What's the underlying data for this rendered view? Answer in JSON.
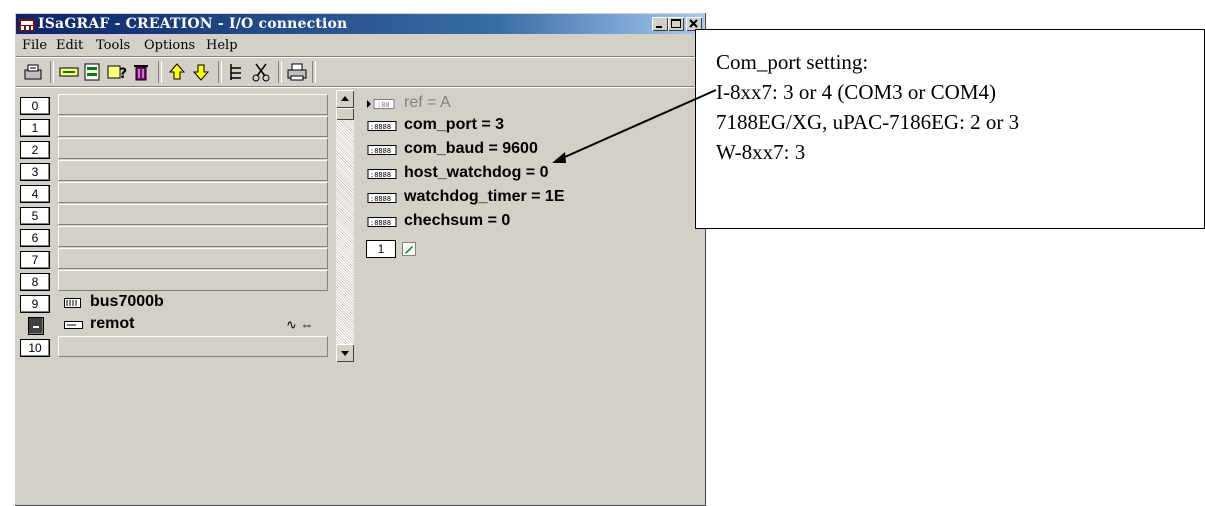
{
  "window": {
    "title": "ISaGRAF - CREATION - I/O connection"
  },
  "menu": {
    "file": "File",
    "edit": "Edit",
    "tools": "Tools",
    "options": "Options",
    "help": "Help"
  },
  "toolbar": {
    "icons": [
      "open-icon",
      "connect-icon",
      "board-icon",
      "help-icon",
      "delete-icon",
      "up-arrow-icon",
      "down-arrow-icon",
      "tree-icon",
      "cut-icon",
      "print-icon"
    ]
  },
  "slots": {
    "s0": "0",
    "s1": "1",
    "s2": "2",
    "s3": "3",
    "s4": "4",
    "s5": "5",
    "s6": "6",
    "s7": "7",
    "s8": "8",
    "s9": "9",
    "bus_label": "bus7000b",
    "remot_label": "remot",
    "remot_symbols": "∿ ⇔",
    "s10": "10"
  },
  "params": {
    "ref": "ref = A",
    "com_port": "com_port = 3",
    "com_baud": "com_baud = 9600",
    "host_watchdog": "host_watchdog = 0",
    "watchdog_timer": "watchdog_timer = 1E",
    "chechsum": "chechsum = 0",
    "board_num": "1"
  },
  "callout": {
    "line1": "Com_port setting:",
    "line2": "I-8xx7: 3 or 4 (COM3 or COM4)",
    "line3": "7188EG/XG, uPAC-7186EG: 2 or 3",
    "line4": "W-8xx7: 3"
  }
}
